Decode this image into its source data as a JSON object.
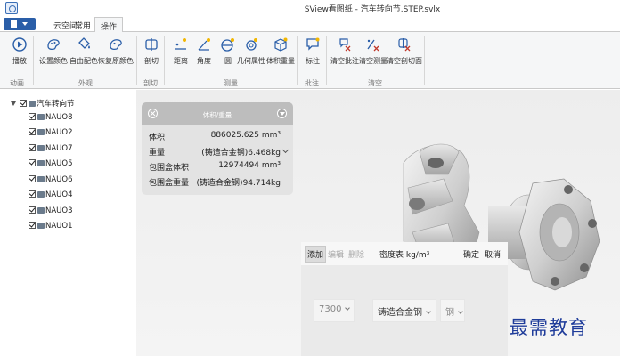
{
  "window": {
    "title": "SView看图纸 - 汽车转向节.STEP.svlx"
  },
  "tabs": [
    {
      "label": "云空间"
    },
    {
      "label": "常用"
    },
    {
      "label": "操作"
    }
  ],
  "ribbon": {
    "buttons": {
      "play": "播放",
      "set_color": "设置颜色",
      "free_color": "自由配色",
      "restore_color": "恢复原颜色",
      "section": "剖切",
      "distance": "距离",
      "angle": "角度",
      "circle": "圆",
      "geometry": "几何属性",
      "volume_weight": "体积重量",
      "annotate": "标注",
      "clear_annot": "清空批注",
      "clear_measure": "清空测量",
      "clear_section": "清空剖切面"
    },
    "groups": {
      "animation": "动画",
      "appearance": "外观",
      "section": "剖切",
      "measure": "测量",
      "annotation": "批注",
      "clear": "清空"
    }
  },
  "tree": {
    "root": "汽车转向节",
    "items": [
      "NAUO8",
      "NAUO2",
      "NAUO7",
      "NAUO5",
      "NAUO6",
      "NAUO4",
      "NAUO3",
      "NAUO1"
    ]
  },
  "volume_panel": {
    "title": "体积/重量",
    "rows": [
      {
        "label": "体积",
        "value": "886025.625 mm³"
      },
      {
        "label": "重量",
        "value": "(铸造合金钢)6.468kg"
      },
      {
        "label": "包围盒体积",
        "value": "12974494 mm³"
      },
      {
        "label": "包围盒重量",
        "value": "(铸造合金钢)94.714kg"
      }
    ]
  },
  "density_panel": {
    "add": "添加",
    "edit": "编辑",
    "delete": "删除",
    "label": "密度表 kg/m³",
    "ok": "确定",
    "cancel": "取消",
    "density_value": "7300",
    "material_type": "铸造合金钢",
    "material": "钢"
  },
  "watermark": "最需教育",
  "colors": {
    "ribbon_bg": "#f5f6f7",
    "accent": "#2a5ea8",
    "watermark": "#1f3c9a"
  }
}
